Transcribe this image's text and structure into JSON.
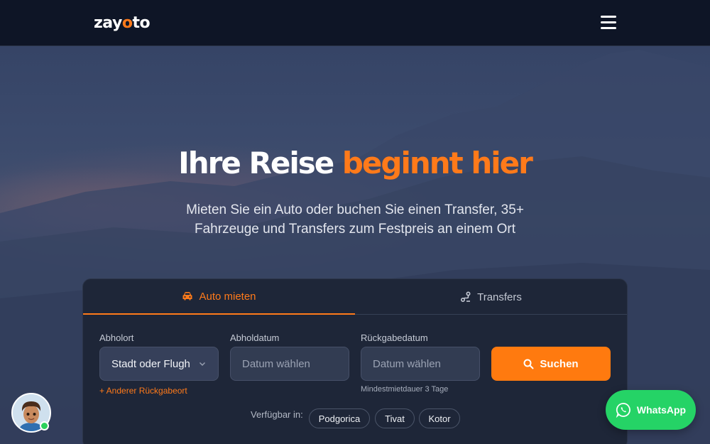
{
  "brand": {
    "logo_text_1": "zay",
    "logo_dot": "o",
    "logo_text_2": "to"
  },
  "nav": {
    "menu_icon": "hamburger-menu-icon"
  },
  "hero": {
    "title_part1": "Ihre Reise ",
    "title_accent": "beginnt hier",
    "subtitle_line1": "Mieten Sie ein Auto oder buchen Sie einen Transfer, 35+",
    "subtitle_line2": "Fahrzeuge und Transfers zum Festpreis an einem Ort"
  },
  "booking": {
    "tabs": [
      {
        "label": "Auto mieten",
        "icon": "car-icon",
        "active": true
      },
      {
        "label": "Transfers",
        "icon": "route-icon",
        "active": false
      }
    ],
    "pickup_label": "Abholort",
    "pickup_value": "Stadt oder Flugh",
    "pickup_date_label": "Abholdatum",
    "pickup_date_placeholder": "Datum wählen",
    "return_date_label": "Rückgabedatum",
    "return_date_placeholder": "Datum wählen",
    "search_label": "Suchen",
    "other_return_link": "+ Anderer Rückgabeort",
    "min_rental_hint": "Mindestmietdauer 3 Tage",
    "available_label": "Verfügbar in:",
    "cities": [
      "Podgorica",
      "Tivat",
      "Kotor"
    ]
  },
  "whatsapp": {
    "label": "WhatsApp"
  },
  "colors": {
    "accent": "#ff7a1a",
    "whatsapp": "#25d366",
    "nav": "#0e1526",
    "card": "#1e2638"
  }
}
